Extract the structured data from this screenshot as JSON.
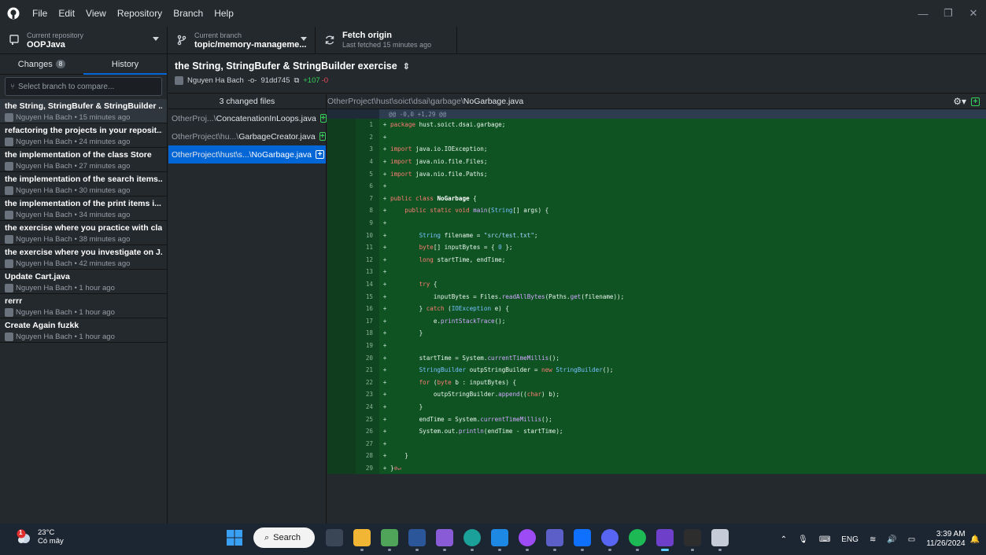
{
  "menu": {
    "items": [
      "File",
      "Edit",
      "View",
      "Repository",
      "Branch",
      "Help"
    ]
  },
  "window_controls": {
    "minimize": "—",
    "restore": "❐",
    "close": "✕"
  },
  "toolbar": {
    "repo_label": "Current repository",
    "repo_value": "OOPJava",
    "branch_label": "Current branch",
    "branch_value": "topic/memory-manageme...",
    "fetch_label": "Fetch origin",
    "fetch_sub": "Last fetched 15 minutes ago"
  },
  "sidebar": {
    "tab_changes": "Changes",
    "changes_count": "8",
    "tab_history": "History",
    "branch_compare_placeholder": "Select branch to compare...",
    "commits": [
      {
        "title": "the String, StringBufer & StringBuilder ...",
        "meta": "Nguyen Ha Bach • 15 minutes ago"
      },
      {
        "title": "refactoring the projects in your reposit...",
        "meta": "Nguyen Ha Bach • 24 minutes ago"
      },
      {
        "title": "the implementation of the class Store",
        "meta": "Nguyen Ha Bach • 27 minutes ago"
      },
      {
        "title": "the implementation of the search items...",
        "meta": "Nguyen Ha Bach • 30 minutes ago"
      },
      {
        "title": "the implementation of the print items i...",
        "meta": "Nguyen Ha Bach • 34 minutes ago"
      },
      {
        "title": "the exercise where you practice with cla...",
        "meta": "Nguyen Ha Bach • 38 minutes ago"
      },
      {
        "title": "the exercise where you investigate on J...",
        "meta": "Nguyen Ha Bach • 42 minutes ago"
      },
      {
        "title": "Update Cart.java",
        "meta": "Nguyen Ha Bach • 1 hour ago"
      },
      {
        "title": "rerrr",
        "meta": "Nguyen Ha Bach • 1 hour ago"
      },
      {
        "title": "Create Again fuzkk",
        "meta": "Nguyen Ha Bach • 1 hour ago"
      }
    ]
  },
  "commit": {
    "title": "the String, StringBufer & StringBuilder exercise",
    "author": "Nguyen Ha Bach",
    "sha": "91dd745",
    "additions": "+107",
    "deletions": "-0"
  },
  "files": {
    "header": "3 changed files",
    "items": [
      {
        "dir": "OtherProj...\\",
        "name": "ConcatenationInLoops.java"
      },
      {
        "dir": "OtherProject\\hu...\\",
        "name": "GarbageCreator.java"
      },
      {
        "dir": "OtherProject\\hust\\s...\\",
        "name": "NoGarbage.java"
      }
    ]
  },
  "diff": {
    "path_dir": "OtherProject\\hust\\soict\\dsai\\garbage\\",
    "path_file": "NoGarbage.java",
    "hunk": "@@ -0,0 +1,29 @@",
    "line_numbers": [
      "1",
      "2",
      "3",
      "4",
      "5",
      "6",
      "7",
      "8",
      "9",
      "10",
      "11",
      "12",
      "13",
      "14",
      "15",
      "16",
      "17",
      "18",
      "19",
      "20",
      "21",
      "22",
      "23",
      "24",
      "25",
      "26",
      "27",
      "28",
      "29"
    ]
  },
  "taskbar": {
    "temp": "23°C",
    "condition": "Có mây",
    "weather_badge": "1",
    "search": "Search",
    "lang": "ENG",
    "time": "3:39 AM",
    "date": "11/26/2024"
  },
  "colors": {
    "accent": "#0366d6",
    "added_bg": "#0f5323",
    "added_text": "#34d058",
    "deleted_text": "#ea4a5a"
  }
}
